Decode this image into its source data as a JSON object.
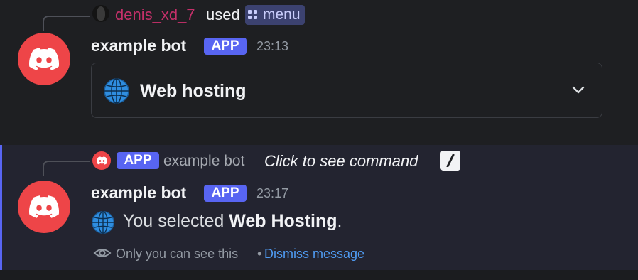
{
  "colors": {
    "background": "#1e1f22",
    "ephemeral_background": "#232430",
    "ephemeral_border": "#5865f2",
    "avatar": "#ee4548",
    "app_badge": "#5865f2",
    "link": "#4f9bf2",
    "username": "#c6306a"
  },
  "message1": {
    "reply": {
      "username": "denis_xd_7",
      "used_text": "used",
      "command_icon": "grid-icon",
      "command_name": "menu"
    },
    "author": "example bot",
    "badge": "APP",
    "timestamp": "23:13",
    "select_menu": {
      "icon": "globe-icon",
      "selected_value": "Web hosting",
      "chevron": "chevron-down-icon"
    }
  },
  "message2": {
    "reply": {
      "badge": "APP",
      "author": "example bot",
      "command_hint": "Click to see command",
      "slash_icon": "slash-command-icon"
    },
    "author": "example bot",
    "badge": "APP",
    "timestamp": "23:17",
    "content": {
      "icon": "globe-icon",
      "prefix": "You selected ",
      "bold": "Web Hosting",
      "suffix": "."
    },
    "ephemeral": {
      "icon": "eye-icon",
      "notice": "Only you can see this",
      "separator": "•",
      "dismiss_label": "Dismiss message"
    }
  }
}
